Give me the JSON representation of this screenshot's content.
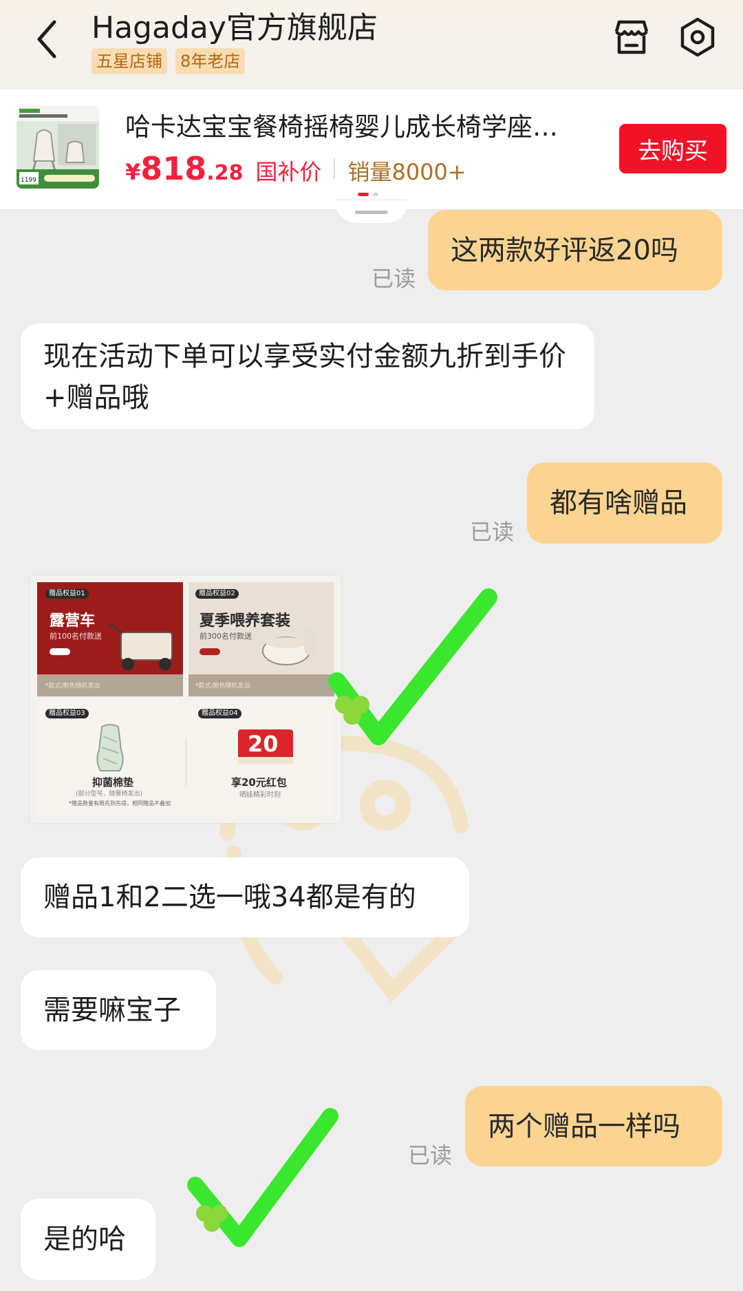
{
  "header": {
    "store_name": "Hagaday官方旗舰店",
    "badges": [
      "五星店铺",
      "8年老店"
    ]
  },
  "product": {
    "title": "哈卡达宝宝餐椅摇椅婴儿成长椅学座…",
    "price_symbol": "¥",
    "price_main": "818",
    "price_decimal": ".28",
    "price_tag": "国补价",
    "sales": "销量8000+",
    "buy_label": "去购买",
    "thumb_price": "1199"
  },
  "messages": {
    "m1": {
      "text": "这两款好评返20吗",
      "read": "已读"
    },
    "m2": {
      "text": "现在活动下单可以享受实付金额九折到手价+赠品哦"
    },
    "m3": {
      "text": "都有啥赠品",
      "read": "已读"
    },
    "m4": {
      "text": "赠品1和2二选一哦34都是有的"
    },
    "m5": {
      "text": "需要嘛宝子"
    },
    "m6": {
      "text": "两个赠品一样吗",
      "read": "已读"
    },
    "m7": {
      "text": "是的哈"
    }
  },
  "gift_image": {
    "g1": {
      "tag": "赠品权益01",
      "title": "露营车",
      "sub": "前100名付款送",
      "note": "*款式/颜色随机发出"
    },
    "g2": {
      "tag": "赠品权益02",
      "title": "夏季喂养套装",
      "sub": "前300名付款送",
      "note": "*款式/颜色随机发出"
    },
    "g3": {
      "tag": "赠品权益03",
      "title": "抑菌棉垫",
      "sub": "(部分型号，随餐椅发出)",
      "note": "*赠品数量有限先到先得，相同赠品不叠加"
    },
    "g4": {
      "tag": "赠品权益04",
      "amount": "20",
      "title": "享20元红包",
      "sub": "晒娃精彩时刻"
    }
  },
  "colors": {
    "accent_red": "#f01328",
    "my_bubble": "#fbd492",
    "check_green": "#3be62e",
    "badge_bg": "#f9dcb3"
  },
  "icons": [
    "back-chevron-icon",
    "store-icon",
    "settings-icon",
    "checkmark-icon",
    "clover-icon"
  ]
}
